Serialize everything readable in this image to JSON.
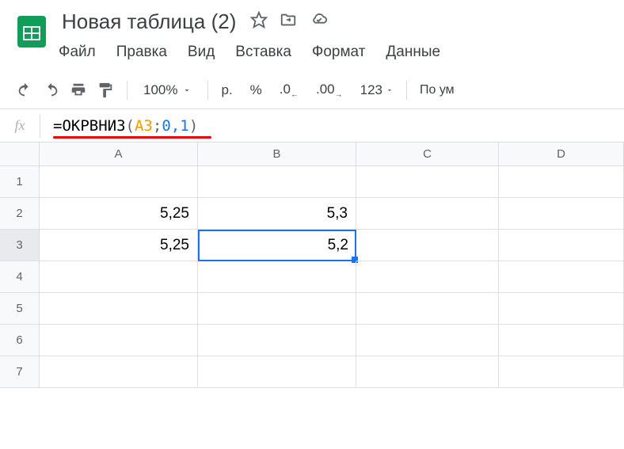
{
  "doc": {
    "title": "Новая таблица (2)"
  },
  "menu": {
    "file": "Файл",
    "edit": "Правка",
    "view": "Вид",
    "insert": "Вставка",
    "format": "Формат",
    "data": "Данные"
  },
  "toolbar": {
    "zoom": "100%",
    "currency": "р.",
    "percent": "%",
    "dec_less": ".0",
    "dec_more": ".00",
    "num123": "123",
    "font_hint": "По ум"
  },
  "formula": {
    "eq": "=",
    "func": "ОКРВНИЗ",
    "open": "(",
    "ref": "A3",
    "sep1": ";",
    "n1": "0",
    "comma": ",",
    "n2": "1",
    "close": ")"
  },
  "columns": [
    "A",
    "B",
    "C",
    "D"
  ],
  "rows": [
    "1",
    "2",
    "3",
    "4",
    "5",
    "6",
    "7"
  ],
  "cells": {
    "A2": "5,25",
    "B2": "5,3",
    "A3": "5,25",
    "B3": "5,2"
  },
  "selection": {
    "cell": "B3",
    "row": 3,
    "col": "B"
  }
}
